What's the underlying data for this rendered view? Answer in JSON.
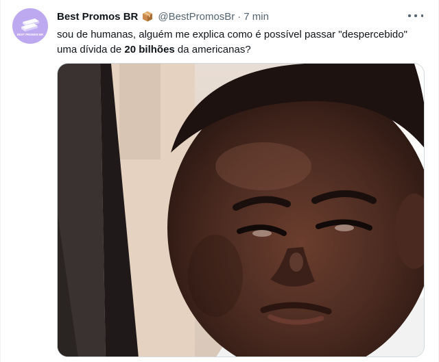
{
  "tweet": {
    "display_name": "Best Promos BR",
    "name_emoji": "package-icon",
    "handle": "@BestPromosBr",
    "separator": "·",
    "time": "7 min",
    "text_part1": "sou de humanas, alguém me explica como é possível passar \"despercebido\" uma dívida de ",
    "text_bold": "20 bilhões",
    "text_part2": " da americanas?",
    "avatar": {
      "icon": "books-icon",
      "caption": "BEST PROMOS BR"
    },
    "media": {
      "kind": "photo",
      "subject": "reaction-meme-photo"
    }
  },
  "colors": {
    "text_primary": "#0f1419",
    "text_secondary": "#536471",
    "avatar_bg": "#bda9f0",
    "border": "#cfd9de"
  }
}
